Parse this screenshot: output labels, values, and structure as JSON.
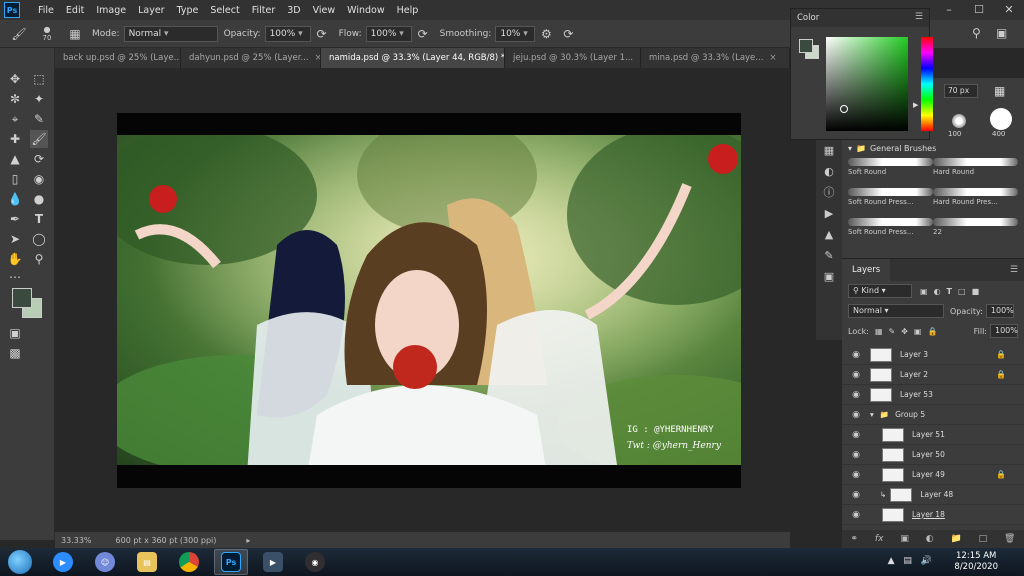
{
  "app": {
    "logo": "Ps"
  },
  "menu": [
    "File",
    "Edit",
    "Image",
    "Layer",
    "Type",
    "Select",
    "Filter",
    "3D",
    "View",
    "Window",
    "Help"
  ],
  "window_controls": [
    "–",
    "☐",
    "✕"
  ],
  "options": {
    "brush_size": "70",
    "mode_label": "Mode:",
    "mode_value": "Normal",
    "opacity_label": "Opacity:",
    "opacity_value": "100%",
    "flow_label": "Flow:",
    "flow_value": "100%",
    "smoothing_label": "Smoothing:",
    "smoothing_value": "10%"
  },
  "tabs": [
    {
      "label": "back up.psd @ 25% (Laye...",
      "active": false
    },
    {
      "label": "dahyun.psd @ 25% (Layer...",
      "active": false
    },
    {
      "label": "namida.psd @ 33.3% (Layer 44, RGB/8) *",
      "active": true
    },
    {
      "label": "jeju.psd @ 30.3% (Layer 1...",
      "active": false
    },
    {
      "label": "mina.psd @ 33.3% (Laye...",
      "active": false
    }
  ],
  "canvas": {
    "watermark_ig": "IG : @YHERNHENRY",
    "watermark_twt": "Twt : @yhern_Henry"
  },
  "status": {
    "zoom": "33.33%",
    "doc_info": "600 pt x 360 pt (300 ppi)"
  },
  "color_panel": {
    "title": "Color",
    "accent": "#22cc22"
  },
  "brush_settings": {
    "size": "70 px",
    "tip_left": "100",
    "tip_right": "400"
  },
  "brushes": {
    "folder": "General Brushes",
    "items": [
      "Soft Round",
      "Hard Round",
      "Soft Round Press...",
      "Hard Round Pres...",
      "Soft Round Press...",
      "22"
    ]
  },
  "layers": {
    "tab": "Layers",
    "filter": "Kind",
    "blend": "Normal",
    "opacity_label": "Opacity:",
    "opacity_value": "100%",
    "lock_label": "Lock:",
    "fill_label": "Fill:",
    "fill_value": "100%",
    "items": [
      {
        "name": "Layer 3",
        "locked": true,
        "indent": 0
      },
      {
        "name": "Layer 2",
        "locked": true,
        "indent": 0
      },
      {
        "name": "Layer 53",
        "locked": false,
        "indent": 0
      },
      {
        "name": "Group 5",
        "locked": false,
        "indent": 0,
        "group": true
      },
      {
        "name": "Layer 51",
        "locked": false,
        "indent": 1
      },
      {
        "name": "Layer 50",
        "locked": false,
        "indent": 1
      },
      {
        "name": "Layer 49",
        "locked": true,
        "indent": 1
      },
      {
        "name": "Layer 48",
        "locked": false,
        "indent": 1
      },
      {
        "name": "Layer 18",
        "locked": false,
        "indent": 1
      }
    ]
  },
  "taskbar": {
    "time": "12:15 AM",
    "date": "8/20/2020"
  }
}
